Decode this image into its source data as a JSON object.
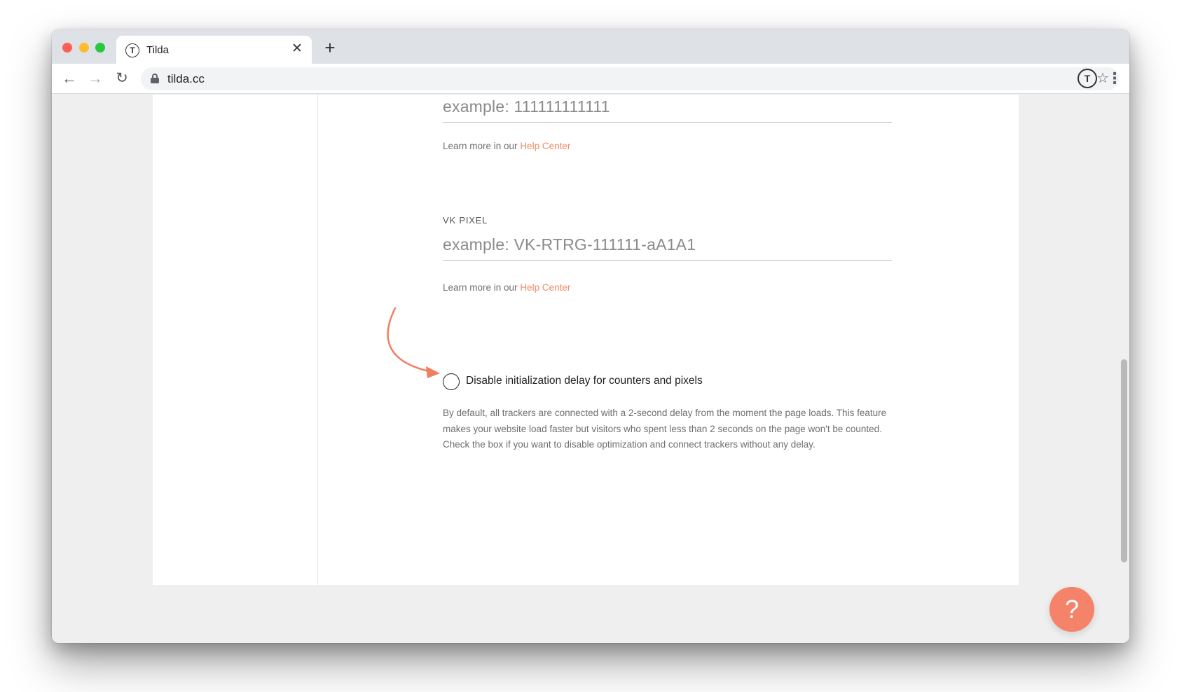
{
  "browser": {
    "tab": {
      "title": "Tilda",
      "favicon": "T",
      "close_glyph": "✕"
    },
    "new_tab_glyph": "+",
    "nav": {
      "back_glyph": "←",
      "forward_glyph": "→",
      "reload_glyph": "↻"
    },
    "address": {
      "url": "tilda.cc"
    },
    "star_glyph": "☆",
    "profile_glyph": "T",
    "menu_glyph": "⋮"
  },
  "form": {
    "first_field": {
      "placeholder": "example: 111111111111",
      "helper_prefix": "Learn more in our ",
      "helper_link": "Help Center"
    },
    "vk_pixel": {
      "label": "VK PIXEL",
      "placeholder": "example: VK-RTRG-111111-aA1A1",
      "helper_prefix": "Learn more in our ",
      "helper_link": "Help Center"
    },
    "delay_option": {
      "label": "Disable initialization delay for counters and pixels",
      "checked": false,
      "description": "By default, all trackers are connected with a 2-second delay from the moment the page loads. This feature makes your website load faster but visitors who spent less than 2 seconds on the page won't be counted. Check the box if you want to disable optimization and connect trackers without any delay."
    }
  },
  "help_button": {
    "glyph": "?"
  },
  "colors": {
    "accent": "#f4836a",
    "link": "#f08a6a",
    "arrow": "#f07f60"
  }
}
